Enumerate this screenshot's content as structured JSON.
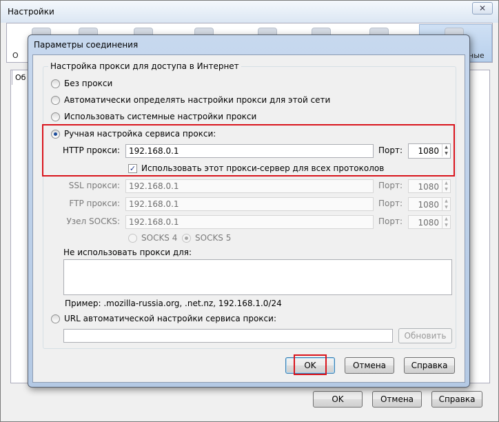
{
  "background_window": {
    "title": "Настройки",
    "close_glyph": "✕",
    "toolbar_partial_labels": [
      "О",
      "ные"
    ],
    "tab_partial_label": "Об",
    "buttons": {
      "ok": "OK",
      "cancel": "Отмена",
      "help": "Справка"
    }
  },
  "dialog": {
    "title": "Параметры соединения",
    "group_title": "Настройка прокси для доступа в Интернет",
    "options": {
      "no_proxy": "Без прокси",
      "auto_detect": "Автоматически определять настройки прокси для этой сети",
      "system": "Использовать системные настройки прокси",
      "manual": "Ручная настройка сервиса прокси:",
      "auto_url": "URL автоматической настройки сервиса прокси:"
    },
    "selected_option": "manual",
    "http": {
      "label": "HTTP прокси:",
      "value": "192.168.0.1",
      "port_label": "Порт:",
      "port": "1080"
    },
    "use_for_all": {
      "label": "Использовать этот прокси-сервер для всех протоколов",
      "checked": true
    },
    "ssl": {
      "label": "SSL прокси:",
      "value": "192.168.0.1",
      "port_label": "Порт:",
      "port": "1080"
    },
    "ftp": {
      "label": "FTP прокси:",
      "value": "192.168.0.1",
      "port_label": "Порт:",
      "port": "1080"
    },
    "socks": {
      "label": "Узел SOCKS:",
      "value": "192.168.0.1",
      "port_label": "Порт:",
      "port": "1080"
    },
    "socks_versions": {
      "v4": "SOCKS 4",
      "v5": "SOCKS 5",
      "selected": "v5"
    },
    "no_proxy_for": {
      "label": "Не использовать прокси для:",
      "value": ""
    },
    "example": "Пример: .mozilla-russia.org, .net.nz, 192.168.1.0/24",
    "auto_url_value": "",
    "reload_button": "Обновить",
    "buttons": {
      "ok": "OK",
      "cancel": "Отмена",
      "help": "Справка"
    }
  },
  "highlight_color": "#d9141c"
}
